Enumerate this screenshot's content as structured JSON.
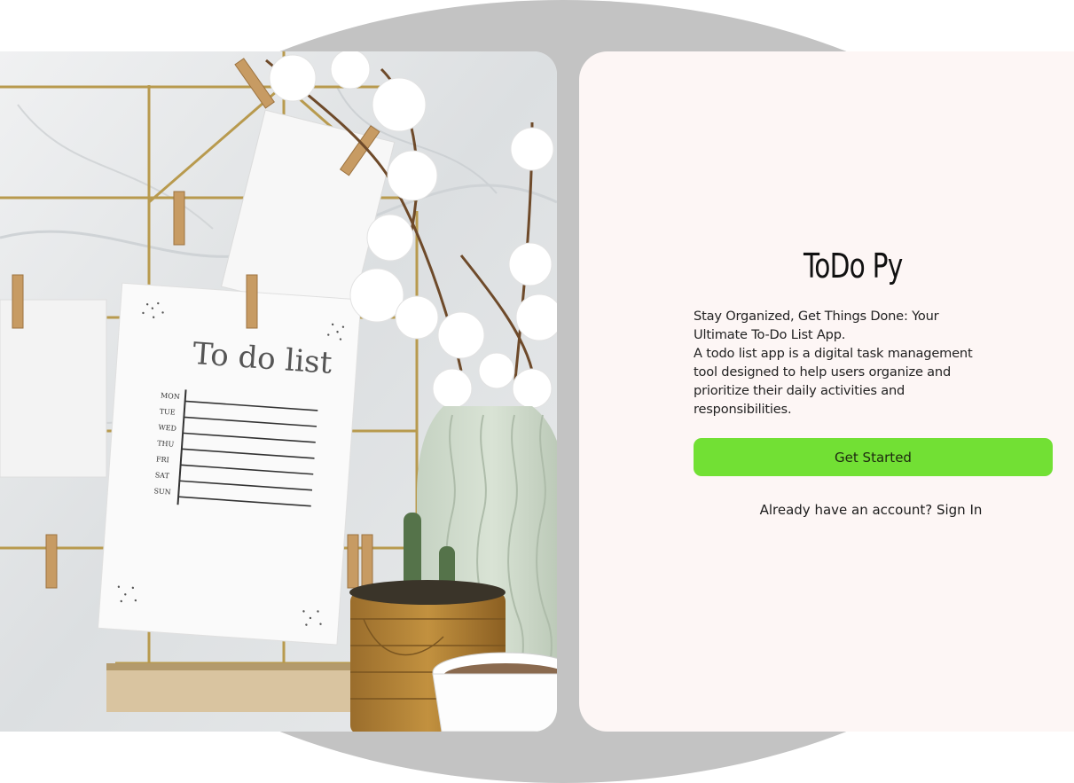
{
  "app": {
    "title": "ToDo Py",
    "tagline": "Stay Organized, Get Things Done: Your Ultimate To-Do List App.",
    "description": "A todo list app is a digital task management tool designed to help users organize and prioritize their daily activities and responsibilities."
  },
  "actions": {
    "get_started_label": "Get Started",
    "sign_in_link": "Already have an account? Sign In"
  },
  "hero_image": {
    "note_title": "To do list",
    "days": [
      "MON",
      "TUE",
      "WED",
      "THU",
      "FRI",
      "SAT",
      "SUN"
    ]
  },
  "colors": {
    "primary_button": "#72e034",
    "panel_background": "#fdf6f5",
    "backdrop": "#c3c3c3"
  }
}
